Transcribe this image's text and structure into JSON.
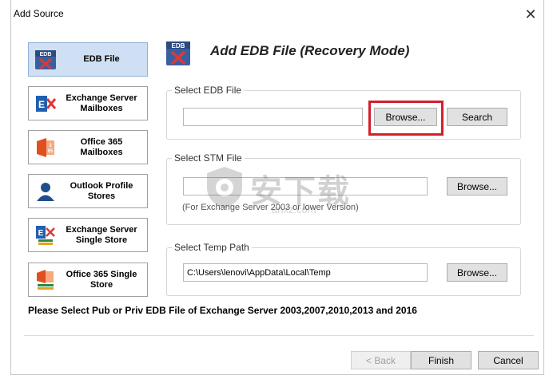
{
  "window": {
    "title": "Add Source",
    "close_glyph": "✕"
  },
  "sidebar": {
    "items": [
      {
        "label": "EDB File",
        "icon": "edb-file-icon",
        "active": true
      },
      {
        "label": "Exchange Server Mailboxes",
        "icon": "exchange-server-icon",
        "active": false
      },
      {
        "label": "Office 365 Mailboxes",
        "icon": "office365-icon",
        "active": false
      },
      {
        "label": "Outlook Profile Stores",
        "icon": "outlook-profile-icon",
        "active": false
      },
      {
        "label": "Exchange Server Single Store",
        "icon": "exchange-single-store-icon",
        "active": false
      },
      {
        "label": "Office 365 Single Store",
        "icon": "office365-single-store-icon",
        "active": false
      }
    ]
  },
  "header": {
    "title": "Add EDB File (Recovery Mode)",
    "icon": "edb-file-icon"
  },
  "edb_group": {
    "legend": "Select EDB File",
    "path_value": "",
    "browse_label": "Browse...",
    "search_label": "Search"
  },
  "stm_group": {
    "legend": "Select STM File",
    "path_value": "",
    "browse_label": "Browse...",
    "note": "(For Exchange Server 2003 or lower Version)"
  },
  "temp_group": {
    "legend": "Select Temp Path",
    "path_value": "C:\\Users\\lenovi\\AppData\\Local\\Temp",
    "browse_label": "Browse..."
  },
  "message": "Please Select Pub or Priv EDB File of Exchange Server 2003,2007,2010,2013 and 2016",
  "footer": {
    "back_label": "< Back",
    "finish_label": "Finish",
    "cancel_label": "Cancel"
  },
  "watermark": {
    "chinese": "安下载",
    "url": "anxz.com"
  },
  "colors": {
    "active_bg": "#cfe0f4",
    "highlight": "#d21f2a",
    "button_bg": "#e1e1e1"
  }
}
